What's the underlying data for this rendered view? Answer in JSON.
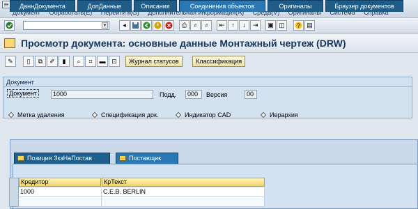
{
  "menubar": {
    "items": [
      "Документ",
      "Обработать(E)",
      "Перейти к(G)",
      "Дополнительная информация(A)",
      "Среда(V)",
      "Оригиналы",
      "Система",
      "Справка"
    ]
  },
  "toolbar": {
    "command_value": "",
    "icons": [
      "check-icon",
      "back-icon",
      "save-icon",
      "back-nav-icon",
      "exit-icon",
      "cancel-icon",
      "print-icon",
      "find-icon",
      "find-next-icon",
      "first-page-icon",
      "prev-page-icon",
      "next-page-icon",
      "last-page-icon",
      "new-session-icon",
      "shortcut-icon",
      "help-icon",
      "layout-icon"
    ]
  },
  "title": {
    "text": "Просмотр документа: основные данные  Монтажный чертеж (DRW)"
  },
  "apptoolbar": {
    "status_log_label": "Журнал статусов",
    "classification_label": "Классификация"
  },
  "document_group": {
    "label": "Документ",
    "doc_label": "Документ",
    "doc_value": "1000",
    "subdoc_label": "Подд.",
    "subdoc_value": "000",
    "version_label": "Версия",
    "version_value": "00",
    "deletion_flag_label": "Метка удаления",
    "spec_label": "Спецификация док.",
    "cad_label": "Индикатор CAD",
    "hierarchy_label": "Иерархия"
  },
  "tabs": [
    {
      "label": "ДаннДокумента"
    },
    {
      "label": "ДопДанные"
    },
    {
      "label": "Описания"
    },
    {
      "label": "Соединения объектов"
    },
    {
      "label": "Оригиналы"
    },
    {
      "label": "Браузер документов"
    }
  ],
  "subtabs": [
    {
      "label": "Позиция ЗкзНаПостав"
    },
    {
      "label": "Поставщик"
    }
  ],
  "table": {
    "columns": [
      "Кредитор",
      "КрТекст"
    ],
    "rows": [
      [
        "1000",
        "C.E.B. BERLIN"
      ],
      [
        "",
        ""
      ]
    ]
  },
  "colors": {
    "title": "#15365f",
    "tab": "#1f5c88",
    "header": "#f0d26b"
  }
}
